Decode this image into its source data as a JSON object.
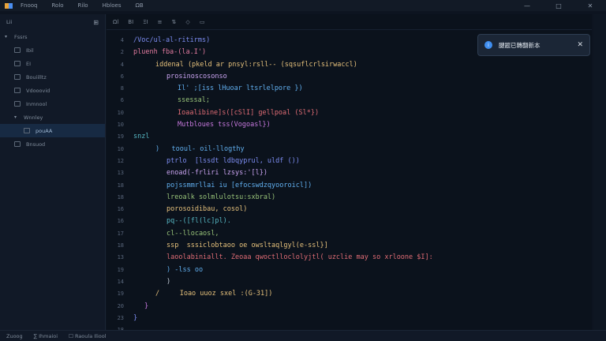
{
  "menu": [
    "Fnooq",
    "Rolo",
    "Rilo",
    "Hbloes",
    "ΩB"
  ],
  "window_controls": [
    "—",
    "□",
    "✕"
  ],
  "sidebar": {
    "header": "Lii",
    "items": [
      {
        "label": "Fssrs",
        "level": 0,
        "type": "folder-open"
      },
      {
        "label": "Ibil",
        "level": 1,
        "type": "file"
      },
      {
        "label": "EI",
        "level": 1,
        "type": "file"
      },
      {
        "label": "Bouiilltz",
        "level": 1,
        "type": "file"
      },
      {
        "label": "Vdooovid",
        "level": 1,
        "type": "file"
      },
      {
        "label": "Inmnool",
        "level": 1,
        "type": "file"
      },
      {
        "label": "Wnnley",
        "level": 1,
        "type": "folder-open"
      },
      {
        "label": "pouAA",
        "level": 2,
        "type": "file",
        "active": true
      },
      {
        "label": "Bnsuod",
        "level": 1,
        "type": "file"
      }
    ]
  },
  "toolbar": [
    "Ωl",
    "BI",
    "ΞI",
    "≡",
    "⇅",
    "◇",
    "▭"
  ],
  "code_lines": [
    {
      "n": "4",
      "indent": 0,
      "text": "/Voc/ul-al-ritirms)",
      "color": "#7c8cf0"
    },
    {
      "n": "2",
      "indent": 0,
      "text": "pluenh fba-(la.I')",
      "color": "#e07a9e"
    },
    {
      "n": "4",
      "indent": 2,
      "text": "iddenal (pkeld ar pnsyl:rsll-- (sqsuflcrlsirwaccl)",
      "color": "#e5c07b"
    },
    {
      "n": "6",
      "indent": 3,
      "text": "prosinoscosonso",
      "color": "#c9a3f0"
    },
    {
      "n": "8",
      "indent": 4,
      "text": "Il' ;[iss lHuoar ltsrlelpore })",
      "color": "#61afef"
    },
    {
      "n": "6",
      "indent": 4,
      "text": "ssessal;",
      "color": "#98c379"
    },
    {
      "n": "10",
      "indent": 4,
      "text": "Ioaalibine]s([cSlI] gellpoal (Sl*})",
      "color": "#e06c75"
    },
    {
      "n": "10",
      "indent": 4,
      "text": "Mutbloues tss(Vogoasl})",
      "color": "#c678dd"
    },
    {
      "n": "19",
      "indent": 0,
      "text": "snzl",
      "color": "#56b6c2"
    },
    {
      "n": "10",
      "indent": 2,
      "text": ")   tooul- oil-llogthy",
      "color": "#61afef"
    },
    {
      "n": "12",
      "indent": 3,
      "text": "ptrlo  [lssdt ldbqyprul, uldf ())",
      "color": "#7c8cf0"
    },
    {
      "n": "13",
      "indent": 3,
      "text": "enoad(-frliri lzsys:'[l})",
      "color": "#c9a3f0"
    },
    {
      "n": "18",
      "indent": 3,
      "text": "pojssmmrllai iu [efocswdzqyooroicl])",
      "color": "#61afef"
    },
    {
      "n": "18",
      "indent": 3,
      "text": "lreoalk solmlulotsu:sxbral)",
      "color": "#98c379"
    },
    {
      "n": "16",
      "indent": 3,
      "text": "porosoidibau, cosol)",
      "color": "#e5c07b"
    },
    {
      "n": "16",
      "indent": 3,
      "text": "pq--([fl(lc]pl).",
      "color": "#56b6c2"
    },
    {
      "n": "17",
      "indent": 3,
      "text": "cl--llocaosl,",
      "color": "#98c379"
    },
    {
      "n": "18",
      "indent": 3,
      "text": "ssp  sssiclobtaoo oe owsltaqlgyl(e-ssl}]",
      "color": "#e5c07b"
    },
    {
      "n": "13",
      "indent": 3,
      "text": "laoolabiniallt. Zeoaa qwoctlloclolyjtl( uzclie may so xrloone $I]:",
      "color": "#e06c75"
    },
    {
      "n": "19",
      "indent": 3,
      "text": ") -lss oo",
      "color": "#61afef"
    },
    {
      "n": "14",
      "indent": 3,
      "text": ")",
      "color": "#c9d3df"
    },
    {
      "n": "19",
      "indent": 2,
      "text": "/     Ioao uuoz sxel :(G-31])",
      "color": "#e5c07b"
    },
    {
      "n": "20",
      "indent": 1,
      "text": "}",
      "color": "#c678dd"
    },
    {
      "n": "23",
      "indent": 0,
      "text": "}",
      "color": "#7c8cf0"
    },
    {
      "n": "18",
      "indent": 0,
      "text": "",
      "color": "#c9d3df"
    }
  ],
  "toast": {
    "message": "腱题已轉翻新本",
    "close": "✕"
  },
  "statusbar": [
    "Zuoog",
    "∑ Ihmaioi",
    "☐ Raoula Iliool"
  ],
  "colors": {
    "accent": "#3f8ef0",
    "active_row": "#172a43",
    "background": "#0b121c"
  }
}
